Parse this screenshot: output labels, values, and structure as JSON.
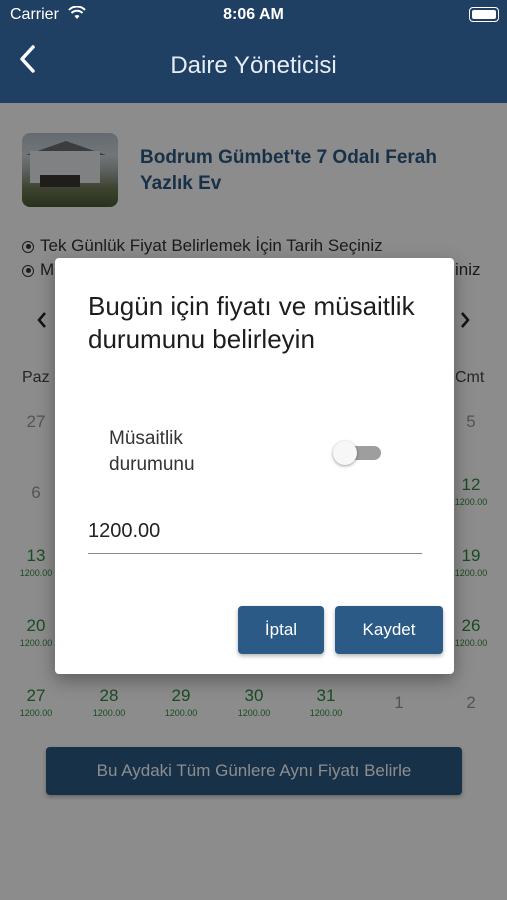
{
  "status": {
    "carrier": "Carrier",
    "time": "8:06 AM"
  },
  "nav": {
    "title": "Daire Yöneticisi",
    "back_glyph": "‹"
  },
  "property": {
    "title": "Bodrum Gümbet'te 7 Odalı Ferah Yazlık Ev"
  },
  "options": [
    "Tek Günlük Fiyat Belirlemek İçin Tarih Seçiniz",
    "M",
    "iniz"
  ],
  "calendar": {
    "prev_glyph": "‹",
    "next_glyph": "›",
    "weekday_first": "Paz",
    "weekday_last": "Cmt",
    "rows": [
      {
        "left": {
          "day": "27",
          "price": "",
          "available": false
        },
        "right": {
          "day": "5",
          "price": "",
          "available": false
        }
      },
      {
        "left": {
          "day": "6",
          "price": "",
          "available": false
        },
        "right": {
          "day": "12",
          "price": "1200.00",
          "available": true
        }
      },
      {
        "left": {
          "day": "13",
          "price": "1200.00",
          "available": true
        },
        "right": {
          "day": "19",
          "price": "1200.00",
          "available": true
        }
      },
      {
        "left": {
          "day": "20",
          "price": "1200.00",
          "available": true
        },
        "right": {
          "day": "26",
          "price": "1200.00",
          "available": true
        }
      }
    ],
    "last_row": [
      {
        "day": "27",
        "price": "1200.00",
        "available": true
      },
      {
        "day": "28",
        "price": "1200.00",
        "available": true
      },
      {
        "day": "29",
        "price": "1200.00",
        "available": true
      },
      {
        "day": "30",
        "price": "1200.00",
        "available": true
      },
      {
        "day": "31",
        "price": "1200.00",
        "available": true
      },
      {
        "day": "1",
        "price": "",
        "available": false
      },
      {
        "day": "2",
        "price": "",
        "available": false
      }
    ]
  },
  "bulk_button": "Bu Aydaki Tüm Günlere Aynı Fiyatı Belirle",
  "dialog": {
    "title": "Bugün için fiyatı ve müsaitlik durumunu belirleyin",
    "availability_label": "Müsaitlik durumunu",
    "availability_on": false,
    "price_value": "1200.00",
    "cancel_label": "İptal",
    "save_label": "Kaydet"
  },
  "colors": {
    "navbar": "#1f3f63",
    "accent": "#2b5a86",
    "available": "#2e8b3e"
  }
}
